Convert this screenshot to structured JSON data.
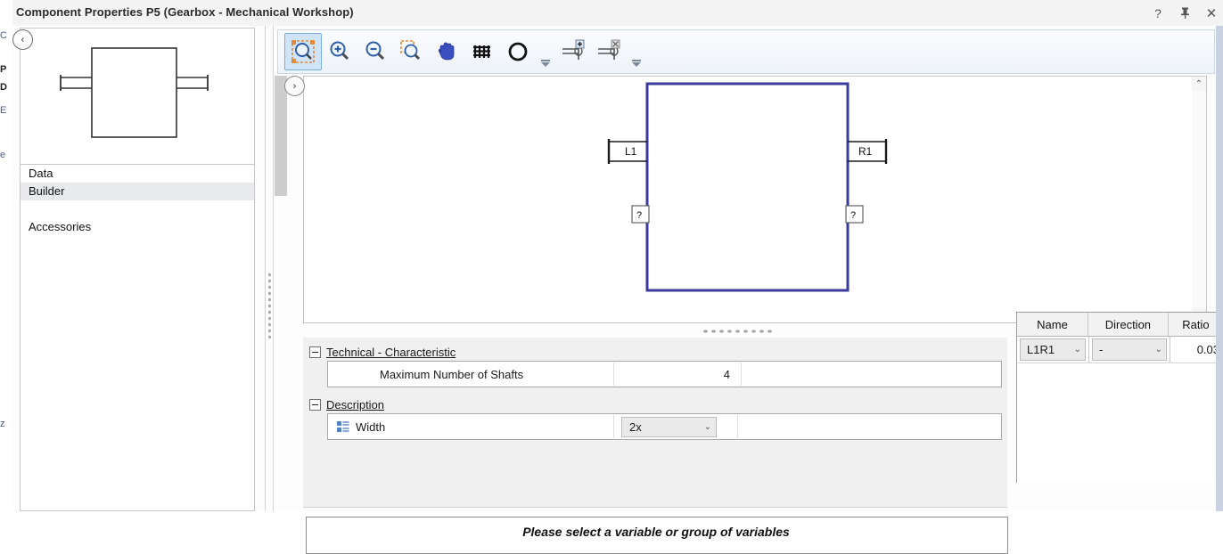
{
  "window": {
    "title": "Component Properties P5 (Gearbox - Mechanical Workshop)",
    "help_icon": "?",
    "pin_icon": "⚗",
    "close_icon": "✕"
  },
  "background_fragments": [
    "C",
    "P",
    "D",
    "E",
    "e",
    "z"
  ],
  "left_panel": {
    "collapse_icon": "‹",
    "preview_name": "gearbox-symbol-preview",
    "tree_items": [
      {
        "label": "Data",
        "selected": false
      },
      {
        "label": "Builder",
        "selected": true
      },
      {
        "label": "Accessories",
        "selected": false
      }
    ]
  },
  "toolbar": {
    "expand_icon": "›",
    "tools": [
      {
        "name": "zoom-fit-icon",
        "label": "Zoom Fit",
        "active": true
      },
      {
        "name": "zoom-in-icon",
        "label": "Zoom In",
        "active": false
      },
      {
        "name": "zoom-out-icon",
        "label": "Zoom Out",
        "active": false
      },
      {
        "name": "zoom-region-icon",
        "label": "Zoom Region",
        "active": false
      },
      {
        "name": "pan-hand-icon",
        "label": "Pan",
        "active": false
      },
      {
        "name": "grid-icon",
        "label": "Grid",
        "active": false
      },
      {
        "name": "circle-icon",
        "label": "Circle",
        "active": false
      },
      {
        "name": "add-shaft-icon",
        "label": "Add Shaft",
        "active": false
      },
      {
        "name": "delete-shaft-icon",
        "label": "Delete Shaft",
        "active": false
      }
    ]
  },
  "canvas": {
    "ports": [
      {
        "id": "L1",
        "label": "L1",
        "side": "left"
      },
      {
        "id": "R1",
        "label": "R1",
        "side": "right"
      },
      {
        "id": "left-unknown",
        "label": "?",
        "side": "left"
      },
      {
        "id": "right-unknown",
        "label": "?",
        "side": "right"
      }
    ],
    "body_color": "#3b3b9e"
  },
  "scrollbar": {
    "up_icon": "⌃",
    "down_icon": "⌄"
  },
  "properties": {
    "groups": [
      {
        "title": "Technical - Characteristic",
        "collapse_icon": "−",
        "rows": [
          {
            "label": "Maximum Number of Shafts",
            "value": "4",
            "type": "number",
            "icon": null
          }
        ]
      },
      {
        "title": "Description",
        "collapse_icon": "−",
        "rows": [
          {
            "label": "Width",
            "value": "2x",
            "type": "combo",
            "icon": "enum-list-icon",
            "caret": "⌄"
          }
        ]
      }
    ]
  },
  "message_panel": {
    "text": "Please select a variable or group of variables"
  },
  "data_grid": {
    "columns": [
      "Name",
      "Direction",
      "Ratio"
    ],
    "rows": [
      {
        "name": "L1R1",
        "direction": "-",
        "ratio": "0.03",
        "caret": "⌄"
      }
    ]
  }
}
